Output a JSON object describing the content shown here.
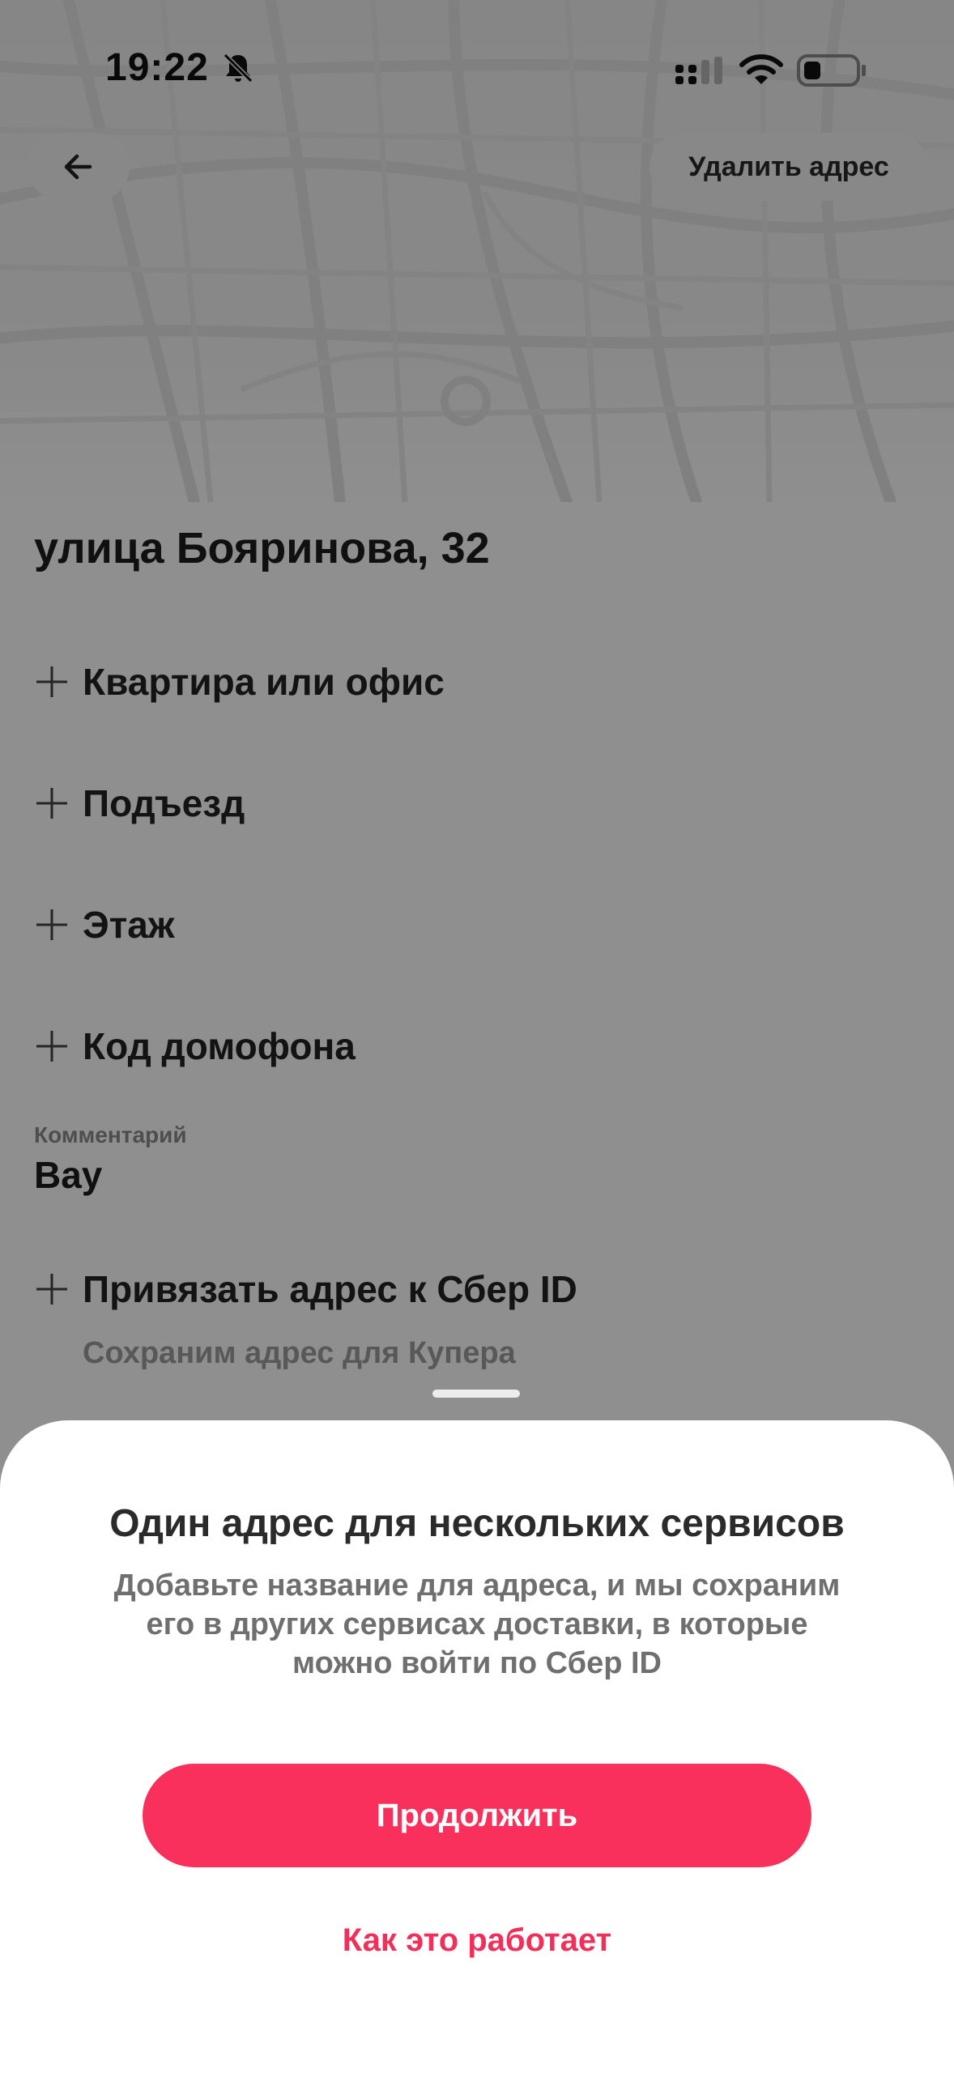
{
  "status_bar": {
    "time": "19:22",
    "icons": [
      "bell-slash-icon",
      "signal-icon",
      "wifi-icon",
      "battery-icon"
    ]
  },
  "header": {
    "back_icon": "arrow-left-icon",
    "delete_label": "Удалить адрес"
  },
  "address": {
    "title": "улица Бояринова, 32",
    "fields": [
      {
        "label": "Квартира или офис",
        "icon": "plus-icon"
      },
      {
        "label": "Подъезд",
        "icon": "plus-icon"
      },
      {
        "label": "Этаж",
        "icon": "plus-icon"
      },
      {
        "label": "Код домофона",
        "icon": "plus-icon"
      }
    ],
    "comment_caption": "Комментарий",
    "comment_value": "Вау",
    "sber_link_label": "Привязать адрес к Сбер ID",
    "sber_link_hint": "Сохраним адрес для Купера"
  },
  "sheet": {
    "title": "Один адрес для нескольких сервисов",
    "description_lines": [
      "Добавьте название для адреса, и мы сохраним",
      "его в других сервисах доставки, в которые",
      "можно войти по Сбер ID"
    ],
    "continue_label": "Продолжить",
    "how_label": "Как это работает"
  },
  "colors": {
    "accent": "#f9305b",
    "link": "#f02f5a",
    "overlay": "rgba(0,0,0,0.44)"
  }
}
